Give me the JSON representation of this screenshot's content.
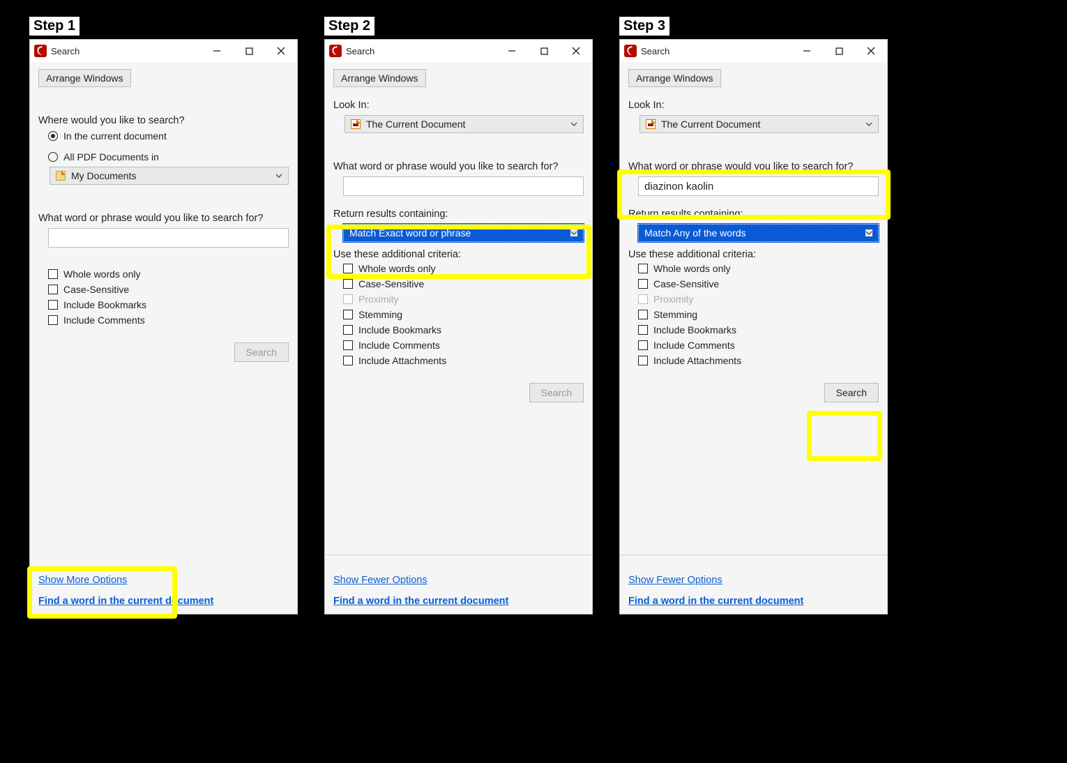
{
  "steps": {
    "s1": "Step 1",
    "s2": "Step 2",
    "s3": "Step 3"
  },
  "titlebar": {
    "title": "Search"
  },
  "arrange": "Arrange Windows",
  "lookIn": {
    "label": "Look In:",
    "value": "The Current Document"
  },
  "where": {
    "label": "Where would you like to search?",
    "radioCurrent": "In the current document",
    "radioAll": "All PDF Documents in",
    "folder": "My Documents"
  },
  "phrase": {
    "label": "What word or phrase would you like to search for?",
    "value3": "diazinon kaolin"
  },
  "returnResults": {
    "label": "Return results containing:",
    "exact": "Match Exact word or phrase",
    "any": "Match Any of the words"
  },
  "criteria": {
    "label": "Use these additional criteria:",
    "whole": "Whole words only",
    "case": "Case-Sensitive",
    "prox": "Proximity",
    "stem": "Stemming",
    "book": "Include Bookmarks",
    "comm": "Include Comments",
    "att": "Include Attachments"
  },
  "buttons": {
    "search": "Search"
  },
  "links": {
    "showMore": "Show More Options",
    "showFewer": "Show Fewer Options",
    "find": "Find a word in the current document"
  }
}
